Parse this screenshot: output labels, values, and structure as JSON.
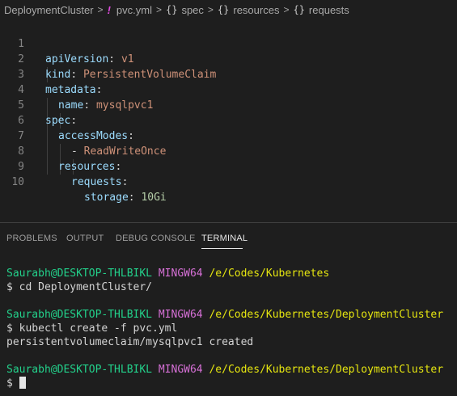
{
  "breadcrumb": {
    "folder": "DeploymentCluster",
    "file_icon": "!",
    "file": "pvc.yml",
    "symbols": [
      "spec",
      "resources",
      "requests"
    ],
    "symbol_icon": "{}",
    "separator": ">"
  },
  "editor": {
    "lines": [
      {
        "num": "1",
        "key": "apiVersion",
        "colon": ": ",
        "value": "v1",
        "vtype": "string"
      },
      {
        "num": "2",
        "key": "kind",
        "colon": ": ",
        "value": "PersistentVolumeClaim",
        "vtype": "string"
      },
      {
        "num": "3",
        "key": "metadata",
        "colon": ":",
        "value": "",
        "vtype": "string"
      },
      {
        "num": "4",
        "key": "name",
        "colon": ": ",
        "value": "mysqlpvc1",
        "vtype": "string"
      },
      {
        "num": "5",
        "key": "spec",
        "colon": ":",
        "value": "",
        "vtype": "string"
      },
      {
        "num": "6",
        "key": "accessModes",
        "colon": ":",
        "value": "",
        "vtype": "string"
      },
      {
        "num": "7",
        "key": "- ",
        "colon": "",
        "value": "ReadWriteOnce",
        "vtype": "string"
      },
      {
        "num": "8",
        "key": "resources",
        "colon": ":",
        "value": "",
        "vtype": "string"
      },
      {
        "num": "9",
        "key": "requests",
        "colon": ":",
        "value": "",
        "vtype": "string"
      },
      {
        "num": "10",
        "key": "storage",
        "colon": ": ",
        "value": "10Gi",
        "vtype": "string"
      }
    ]
  },
  "panel": {
    "tabs": [
      "PROBLEMS",
      "OUTPUT",
      "DEBUG CONSOLE",
      "TERMINAL"
    ],
    "active_tab": "TERMINAL"
  },
  "terminal": {
    "user": "Saurabh@DESKTOP-THLBIKL",
    "env": "MINGW64",
    "prompt_1_path": "/e/Codes/Kubernetes",
    "cmd_1": "$ cd DeploymentCluster/",
    "prompt_2_path": "/e/Codes/Kubernetes/DeploymentCluster",
    "cmd_2": "$ kubectl create -f pvc.yml",
    "output_2": "persistentvolumeclaim/mysqlpvc1 created",
    "prompt_3_path": "/e/Codes/Kubernetes/DeploymentCluster",
    "cmd_3": "$"
  },
  "colors": {
    "background": "#1e1e1e",
    "key": "#9cdcfe",
    "string": "#ce9178",
    "terminal_user": "#23d18b",
    "terminal_env": "#d670d6",
    "terminal_path": "#e5e510"
  }
}
